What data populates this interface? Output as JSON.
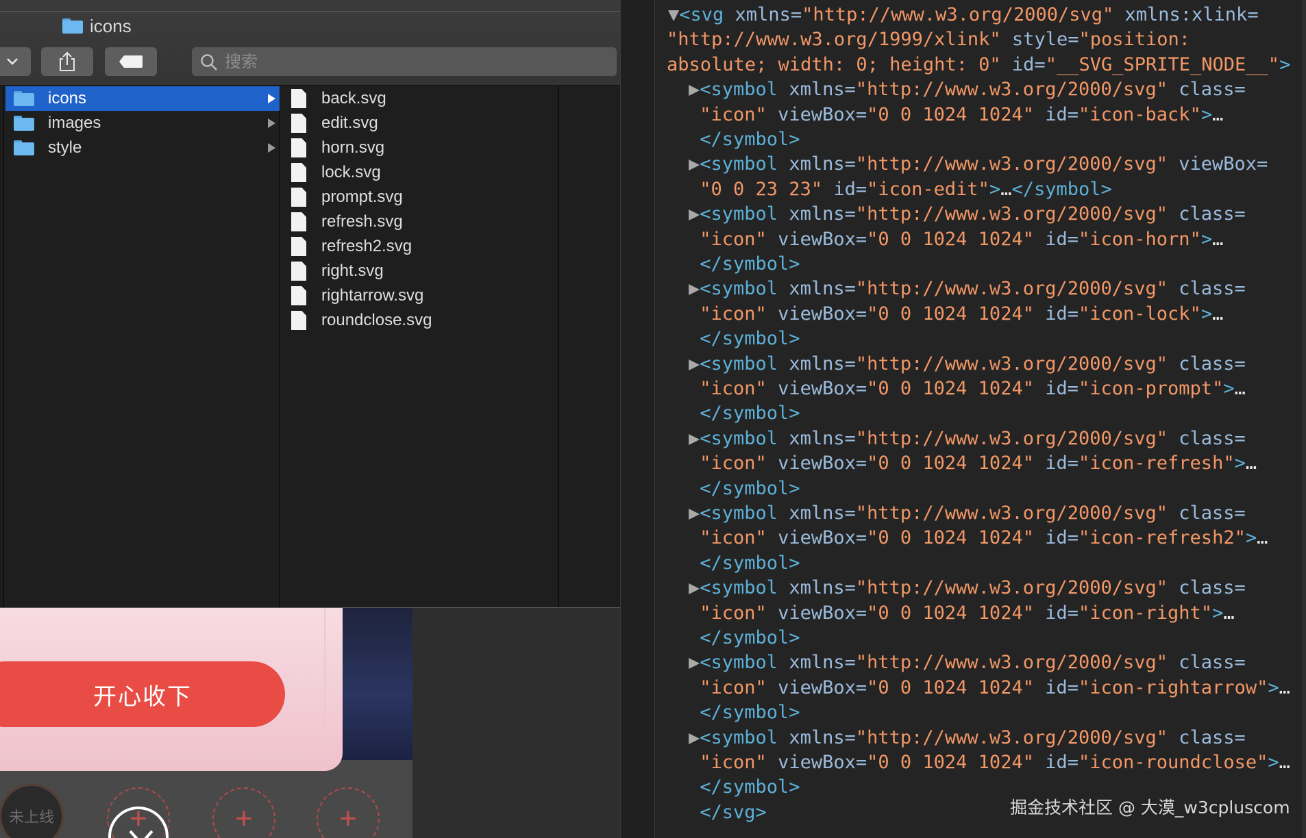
{
  "finder": {
    "title": "icons",
    "search_placeholder": "搜索",
    "folders": [
      {
        "label": "icons",
        "selected": true
      },
      {
        "label": "images",
        "selected": false
      },
      {
        "label": "style",
        "selected": false
      }
    ],
    "files": [
      "back.svg",
      "edit.svg",
      "horn.svg",
      "lock.svg",
      "prompt.svg",
      "refresh.svg",
      "refresh2.svg",
      "right.svg",
      "rightarrow.svg",
      "roundclose.svg"
    ]
  },
  "background_page": {
    "claim_button_label": "开心收下",
    "offline_label": "未上线",
    "slot_plus": "+"
  },
  "devtools": {
    "lines": [
      {
        "arrow": "▼",
        "parts": [
          [
            "tag",
            "<svg "
          ],
          [
            "attr",
            "xmlns="
          ],
          [
            "val",
            "\"http://www.w3.org/2000/svg\""
          ],
          [
            "attr",
            " xmlns:xlink="
          ]
        ]
      },
      {
        "arrow": "",
        "parts": [
          [
            "val",
            "\"http://www.w3.org/1999/xlink\""
          ],
          [
            "attr",
            " style="
          ],
          [
            "val",
            "\"position:"
          ]
        ]
      },
      {
        "arrow": "",
        "parts": [
          [
            "val",
            "absolute; width: 0; height: 0\""
          ],
          [
            "attr",
            " id="
          ],
          [
            "val",
            "\"__SVG_SPRITE_NODE__\""
          ],
          [
            "tag",
            ">"
          ]
        ]
      },
      {
        "arrow": "▶",
        "parts": [
          [
            "tag",
            "<symbol "
          ],
          [
            "attr",
            "xmlns="
          ],
          [
            "val",
            "\"http://www.w3.org/2000/svg\""
          ],
          [
            "attr",
            " class="
          ]
        ]
      },
      {
        "arrow": "",
        "parts": [
          [
            "val",
            "\"icon\""
          ],
          [
            "attr",
            " viewBox="
          ],
          [
            "val",
            "\"0 0 1024 1024\""
          ],
          [
            "attr",
            " id="
          ],
          [
            "val",
            "\"icon-back\""
          ],
          [
            "tag",
            ">"
          ],
          [
            "txt",
            "…"
          ]
        ]
      },
      {
        "arrow": "",
        "parts": [
          [
            "tag",
            "</symbol>"
          ]
        ]
      },
      {
        "arrow": "▶",
        "parts": [
          [
            "tag",
            "<symbol "
          ],
          [
            "attr",
            "xmlns="
          ],
          [
            "val",
            "\"http://www.w3.org/2000/svg\""
          ],
          [
            "attr",
            " viewBox="
          ]
        ]
      },
      {
        "arrow": "",
        "parts": [
          [
            "val",
            "\"0 0 23 23\""
          ],
          [
            "attr",
            " id="
          ],
          [
            "val",
            "\"icon-edit\""
          ],
          [
            "tag",
            ">"
          ],
          [
            "txt",
            "…"
          ],
          [
            "tag",
            "</symbol>"
          ]
        ]
      },
      {
        "arrow": "▶",
        "parts": [
          [
            "tag",
            "<symbol "
          ],
          [
            "attr",
            "xmlns="
          ],
          [
            "val",
            "\"http://www.w3.org/2000/svg\""
          ],
          [
            "attr",
            " class="
          ]
        ]
      },
      {
        "arrow": "",
        "parts": [
          [
            "val",
            "\"icon\""
          ],
          [
            "attr",
            " viewBox="
          ],
          [
            "val",
            "\"0 0 1024 1024\""
          ],
          [
            "attr",
            " id="
          ],
          [
            "val",
            "\"icon-horn\""
          ],
          [
            "tag",
            ">"
          ],
          [
            "txt",
            "…"
          ]
        ]
      },
      {
        "arrow": "",
        "parts": [
          [
            "tag",
            "</symbol>"
          ]
        ]
      },
      {
        "arrow": "▶",
        "parts": [
          [
            "tag",
            "<symbol "
          ],
          [
            "attr",
            "xmlns="
          ],
          [
            "val",
            "\"http://www.w3.org/2000/svg\""
          ],
          [
            "attr",
            " class="
          ]
        ]
      },
      {
        "arrow": "",
        "parts": [
          [
            "val",
            "\"icon\""
          ],
          [
            "attr",
            " viewBox="
          ],
          [
            "val",
            "\"0 0 1024 1024\""
          ],
          [
            "attr",
            " id="
          ],
          [
            "val",
            "\"icon-lock\""
          ],
          [
            "tag",
            ">"
          ],
          [
            "txt",
            "…"
          ]
        ]
      },
      {
        "arrow": "",
        "parts": [
          [
            "tag",
            "</symbol>"
          ]
        ]
      },
      {
        "arrow": "▶",
        "parts": [
          [
            "tag",
            "<symbol "
          ],
          [
            "attr",
            "xmlns="
          ],
          [
            "val",
            "\"http://www.w3.org/2000/svg\""
          ],
          [
            "attr",
            " class="
          ]
        ]
      },
      {
        "arrow": "",
        "parts": [
          [
            "val",
            "\"icon\""
          ],
          [
            "attr",
            " viewBox="
          ],
          [
            "val",
            "\"0 0 1024 1024\""
          ],
          [
            "attr",
            " id="
          ],
          [
            "val",
            "\"icon-prompt\""
          ],
          [
            "tag",
            ">"
          ],
          [
            "txt",
            "…"
          ]
        ]
      },
      {
        "arrow": "",
        "parts": [
          [
            "tag",
            "</symbol>"
          ]
        ]
      },
      {
        "arrow": "▶",
        "parts": [
          [
            "tag",
            "<symbol "
          ],
          [
            "attr",
            "xmlns="
          ],
          [
            "val",
            "\"http://www.w3.org/2000/svg\""
          ],
          [
            "attr",
            " class="
          ]
        ]
      },
      {
        "arrow": "",
        "parts": [
          [
            "val",
            "\"icon\""
          ],
          [
            "attr",
            " viewBox="
          ],
          [
            "val",
            "\"0 0 1024 1024\""
          ],
          [
            "attr",
            " id="
          ],
          [
            "val",
            "\"icon-refresh\""
          ],
          [
            "tag",
            ">"
          ],
          [
            "txt",
            "…"
          ]
        ]
      },
      {
        "arrow": "",
        "parts": [
          [
            "tag",
            "</symbol>"
          ]
        ]
      },
      {
        "arrow": "▶",
        "parts": [
          [
            "tag",
            "<symbol "
          ],
          [
            "attr",
            "xmlns="
          ],
          [
            "val",
            "\"http://www.w3.org/2000/svg\""
          ],
          [
            "attr",
            " class="
          ]
        ]
      },
      {
        "arrow": "",
        "parts": [
          [
            "val",
            "\"icon\""
          ],
          [
            "attr",
            " viewBox="
          ],
          [
            "val",
            "\"0 0 1024 1024\""
          ],
          [
            "attr",
            " id="
          ],
          [
            "val",
            "\"icon-refresh2\""
          ],
          [
            "tag",
            ">"
          ],
          [
            "txt",
            "…"
          ]
        ]
      },
      {
        "arrow": "",
        "parts": [
          [
            "tag",
            "</symbol>"
          ]
        ]
      },
      {
        "arrow": "▶",
        "parts": [
          [
            "tag",
            "<symbol "
          ],
          [
            "attr",
            "xmlns="
          ],
          [
            "val",
            "\"http://www.w3.org/2000/svg\""
          ],
          [
            "attr",
            " class="
          ]
        ]
      },
      {
        "arrow": "",
        "parts": [
          [
            "val",
            "\"icon\""
          ],
          [
            "attr",
            " viewBox="
          ],
          [
            "val",
            "\"0 0 1024 1024\""
          ],
          [
            "attr",
            " id="
          ],
          [
            "val",
            "\"icon-right\""
          ],
          [
            "tag",
            ">"
          ],
          [
            "txt",
            "…"
          ]
        ]
      },
      {
        "arrow": "",
        "parts": [
          [
            "tag",
            "</symbol>"
          ]
        ]
      },
      {
        "arrow": "▶",
        "parts": [
          [
            "tag",
            "<symbol "
          ],
          [
            "attr",
            "xmlns="
          ],
          [
            "val",
            "\"http://www.w3.org/2000/svg\""
          ],
          [
            "attr",
            " class="
          ]
        ]
      },
      {
        "arrow": "",
        "parts": [
          [
            "val",
            "\"icon\""
          ],
          [
            "attr",
            " viewBox="
          ],
          [
            "val",
            "\"0 0 1024 1024\""
          ],
          [
            "attr",
            " id="
          ],
          [
            "val",
            "\"icon-rightarrow\""
          ],
          [
            "tag",
            ">"
          ],
          [
            "txt",
            "…"
          ]
        ]
      },
      {
        "arrow": "",
        "parts": [
          [
            "tag",
            "</symbol>"
          ]
        ]
      },
      {
        "arrow": "▶",
        "parts": [
          [
            "tag",
            "<symbol "
          ],
          [
            "attr",
            "xmlns="
          ],
          [
            "val",
            "\"http://www.w3.org/2000/svg\""
          ],
          [
            "attr",
            " class="
          ]
        ]
      },
      {
        "arrow": "",
        "parts": [
          [
            "val",
            "\"icon\""
          ],
          [
            "attr",
            " viewBox="
          ],
          [
            "val",
            "\"0 0 1024 1024\""
          ],
          [
            "attr",
            " id="
          ],
          [
            "val",
            "\"icon-roundclose\""
          ],
          [
            "tag",
            ">"
          ],
          [
            "txt",
            "…"
          ]
        ]
      },
      {
        "arrow": "",
        "parts": [
          [
            "tag",
            "</symbol>"
          ]
        ]
      },
      {
        "arrow": "",
        "parts": [
          [
            "tag",
            "</svg>"
          ]
        ]
      }
    ]
  },
  "watermark": "掘金技术社区 @ 大漠_w3cpluscom",
  "colors": {
    "selection": "#1f62c9",
    "tag": "#5db0d7",
    "attr_name": "#9bbbdc",
    "attr_value": "#f29766",
    "claim_button": "#e84c45"
  },
  "icons": [
    "folder-icon",
    "file-icon",
    "share-icon",
    "tag-icon",
    "search-icon",
    "chevron-down-icon",
    "disclosure-arrow-icon",
    "close-icon"
  ]
}
